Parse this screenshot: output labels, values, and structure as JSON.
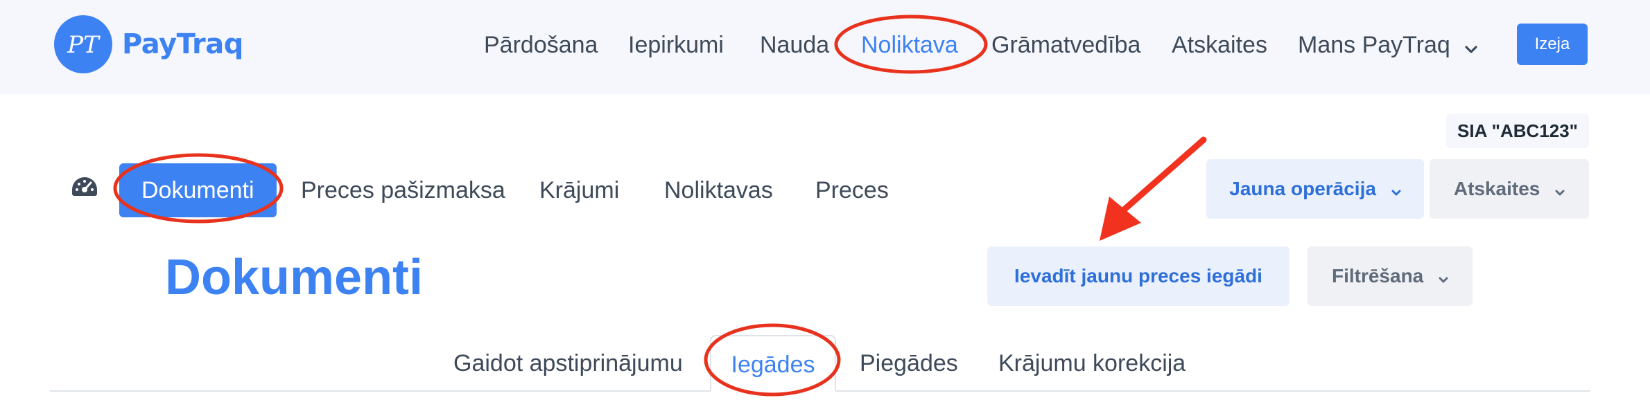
{
  "brand": {
    "logo_text": "PayTraq",
    "logo_monogram": "PT",
    "accent_color": "#3d82f3"
  },
  "topnav": {
    "items": [
      {
        "label": "Pārdošana"
      },
      {
        "label": "Iepirkumi"
      },
      {
        "label": "Nauda"
      },
      {
        "label": "Noliktava",
        "active": true
      },
      {
        "label": "Grāmatvedība"
      },
      {
        "label": "Atskaites"
      },
      {
        "label": "Mans PayTraq",
        "dropdown": true
      }
    ],
    "exit_label": "Izeja"
  },
  "company": {
    "name": "SIA \"ABC123\""
  },
  "subnav": {
    "dashboard_icon": "speedometer-icon",
    "items": [
      {
        "label": "Dokumenti",
        "active": true
      },
      {
        "label": "Preces pašizmaksa"
      },
      {
        "label": "Krājumi"
      },
      {
        "label": "Noliktavas"
      },
      {
        "label": "Preces"
      }
    ],
    "new_operation_label": "Jauna operācija",
    "reports_label": "Atskaites"
  },
  "page": {
    "title": "Dokumenti",
    "new_purchase_label": "Ievadīt jaunu preces iegādi",
    "filter_label": "Filtrēšana"
  },
  "tabs": [
    {
      "label": "Gaidot apstiprinājumu"
    },
    {
      "label": "Iegādes",
      "active": true
    },
    {
      "label": "Piegādes"
    },
    {
      "label": "Krājumu korekcija"
    }
  ],
  "annotations": {
    "highlight_color": "#e8321d",
    "arrow_color": "#f0321e"
  }
}
